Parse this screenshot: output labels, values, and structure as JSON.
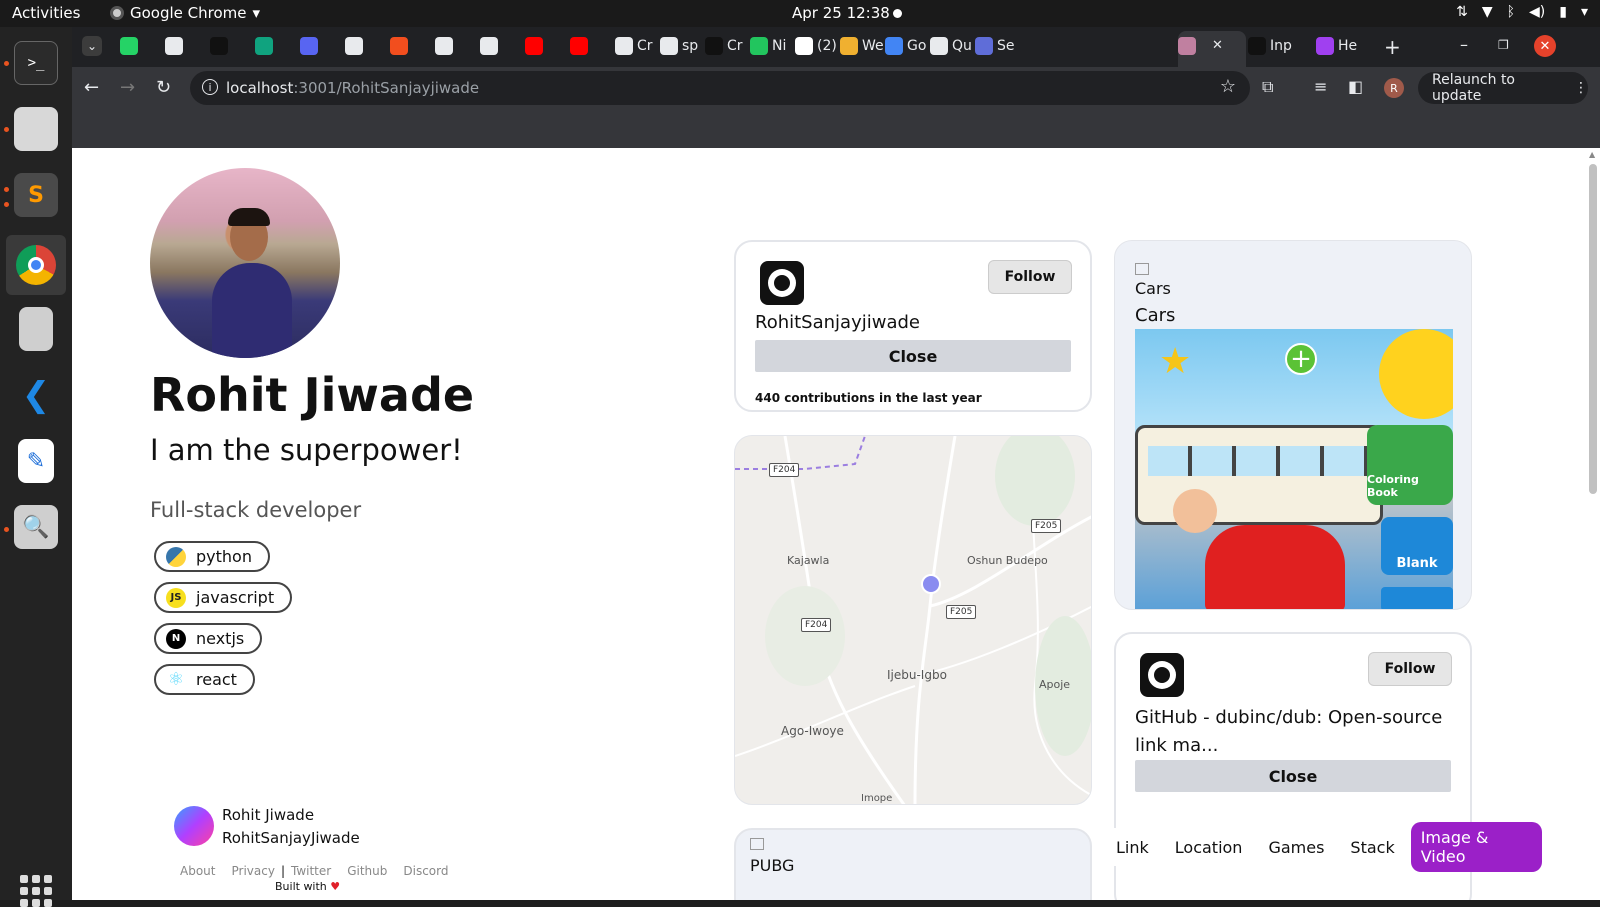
{
  "system": {
    "activities": "Activities",
    "app_name": "Google Chrome",
    "clock": "Apr 25  12:38"
  },
  "browser": {
    "tabs": [
      {
        "icon": "whatsapp-icon",
        "color": "#25d366",
        "label": ""
      },
      {
        "icon": "github-icon",
        "color": "#e8eaed",
        "label": ""
      },
      {
        "icon": "vercel-icon",
        "color": "#111111",
        "label": ""
      },
      {
        "icon": "chatgpt-icon",
        "color": "#10a37f",
        "label": ""
      },
      {
        "icon": "discord-icon",
        "color": "#5865f2",
        "label": ""
      },
      {
        "icon": "github-icon",
        "color": "#e8eaed",
        "label": ""
      },
      {
        "icon": "figma-icon",
        "color": "#f24e1e",
        "label": ""
      },
      {
        "icon": "github-icon",
        "color": "#e8eaed",
        "label": ""
      },
      {
        "icon": "github-icon",
        "color": "#e8eaed",
        "label": ""
      },
      {
        "icon": "youtube-icon",
        "color": "#ff0000",
        "label": ""
      },
      {
        "icon": "youtube-icon",
        "color": "#ff0000",
        "label": ""
      },
      {
        "icon": "globe-icon",
        "color": "#e8eaed",
        "label": "Cr"
      },
      {
        "icon": "github-icon",
        "color": "#e8eaed",
        "label": "sp"
      },
      {
        "icon": "vercel-icon",
        "color": "#111111",
        "label": "Cr"
      },
      {
        "icon": "nitro-icon",
        "color": "#22c55e",
        "label": "Ni"
      },
      {
        "icon": "notion-icon",
        "color": "#ffffff",
        "label": "(2)"
      },
      {
        "icon": "weather-icon",
        "color": "#f0b030",
        "label": "We"
      },
      {
        "icon": "translate-icon",
        "color": "#4285f4",
        "label": "Go"
      },
      {
        "icon": "quill-icon",
        "color": "#e8eaed",
        "label": "Qu"
      },
      {
        "icon": "settings-icon",
        "color": "#5f6dd8",
        "label": "Se"
      },
      {
        "icon": "photo-icon",
        "color": "#c080a0",
        "label": ""
      },
      {
        "icon": "input-icon",
        "color": "#111111",
        "label": "Inp"
      },
      {
        "icon": "shield-icon",
        "color": "#a040f0",
        "label": "He"
      }
    ],
    "url_host": "localhost",
    "url_path": ":3001/RohitSanjayjiwade",
    "relaunch_label": "Relaunch to update",
    "profile_initial": "R"
  },
  "profile": {
    "name": "Rohit Jiwade",
    "tagline": "I am the superpower!",
    "role": "Full-stack developer",
    "skills": [
      {
        "label": "python",
        "icon": "python-icon",
        "color": "#3776ab"
      },
      {
        "label": "javascript",
        "icon": "javascript-icon",
        "color": "#f7df1e",
        "glyph": "JS"
      },
      {
        "label": "nextjs",
        "icon": "nextjs-icon",
        "color": "#000000",
        "glyph": "N"
      },
      {
        "label": "react",
        "icon": "react-icon",
        "color": "#61dafb"
      }
    ]
  },
  "footer": {
    "name": "Rohit Jiwade",
    "handle": "RohitSanjayJiwade",
    "links": [
      "About",
      "Privacy",
      "Twitter",
      "Github",
      "Discord"
    ],
    "built_with": "Built with"
  },
  "github_card": {
    "username": "RohitSanjayjiwade",
    "follow_label": "Follow",
    "close_label": "Close",
    "contributions": "440 contributions in the last year"
  },
  "map_card": {
    "places": [
      "Kajawla",
      "Oshun Budepo",
      "Ijebu-Igbo",
      "Apoje",
      "Ago-Iwoye",
      "Imope"
    ],
    "roads": [
      "F204",
      "F205",
      "F205",
      "F204"
    ]
  },
  "cars_card": {
    "alt_text": "Cars",
    "title": "Cars",
    "game_texts": [
      "Coloring Book",
      "Blank"
    ]
  },
  "dub_card": {
    "title": "GitHub - dubinc/dub: Open-source link ma...",
    "follow_label": "Follow",
    "close_label": "Close"
  },
  "pubg_card": {
    "alt_text": "PUBG"
  },
  "bottom_nav": {
    "items": [
      "Link",
      "Location",
      "Games",
      "Stack",
      "Image & Video"
    ],
    "active": "Image & Video"
  }
}
